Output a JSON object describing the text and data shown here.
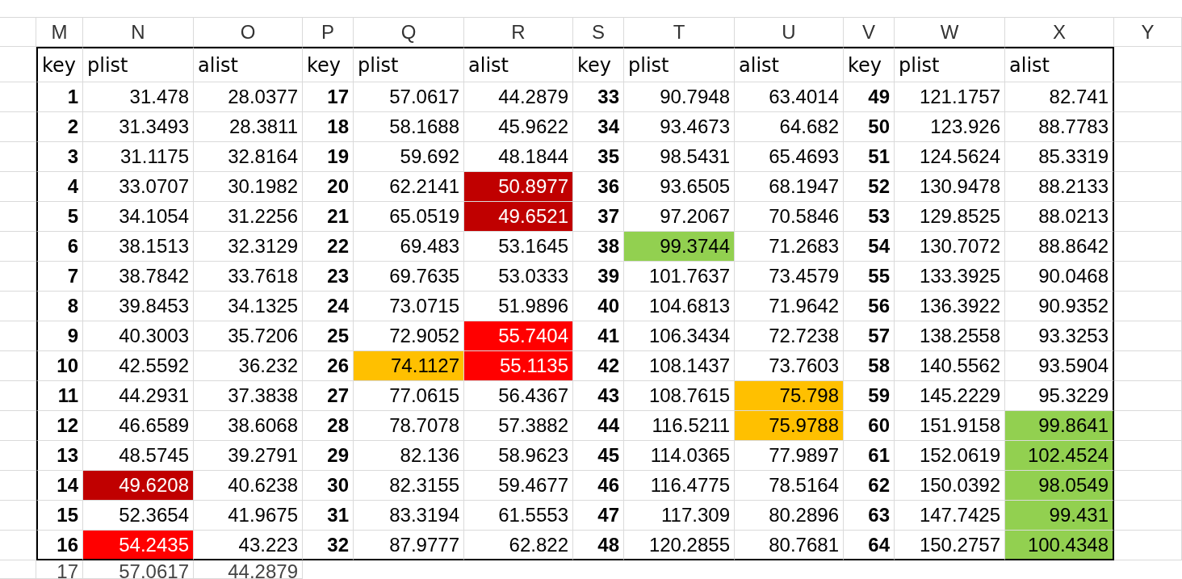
{
  "column_headers": [
    "M",
    "N",
    "O",
    "P",
    "Q",
    "R",
    "S",
    "T",
    "U",
    "V",
    "W",
    "X",
    "Y"
  ],
  "table": {
    "header": [
      "key",
      "plist",
      "alist",
      "key",
      "plist",
      "alist",
      "key",
      "plist",
      "alist",
      "key",
      "plist",
      "alist"
    ],
    "rows": [
      [
        "1",
        "31.478",
        "28.0377",
        "17",
        "57.0617",
        "44.2879",
        "33",
        "90.7948",
        "63.4014",
        "49",
        "121.1757",
        "82.741"
      ],
      [
        "2",
        "31.3493",
        "28.3811",
        "18",
        "58.1688",
        "45.9622",
        "34",
        "93.4673",
        "64.682",
        "50",
        "123.926",
        "88.7783"
      ],
      [
        "3",
        "31.1175",
        "32.8164",
        "19",
        "59.692",
        "48.1844",
        "35",
        "98.5431",
        "65.4693",
        "51",
        "124.5624",
        "85.3319"
      ],
      [
        "4",
        "33.0707",
        "30.1982",
        "20",
        "62.2141",
        {
          "text": "50.8977",
          "color": "#c00000"
        },
        "36",
        "93.6505",
        "68.1947",
        "52",
        "130.9478",
        "88.2133"
      ],
      [
        "5",
        "34.1054",
        "31.2256",
        "21",
        "65.0519",
        {
          "text": "49.6521",
          "color": "#c00000"
        },
        "37",
        "97.2067",
        "70.5846",
        "53",
        "129.8525",
        "88.0213"
      ],
      [
        "6",
        "38.1513",
        "32.3129",
        "22",
        "69.483",
        "53.1645",
        "38",
        {
          "text": "99.3744",
          "color": "#92d050"
        },
        "71.2683",
        "54",
        "130.7072",
        "88.8642"
      ],
      [
        "7",
        "38.7842",
        "33.7618",
        "23",
        "69.7635",
        "53.0333",
        "39",
        "101.7637",
        "73.4579",
        "55",
        "133.3925",
        "90.0468"
      ],
      [
        "8",
        "39.8453",
        "34.1325",
        "24",
        "73.0715",
        "51.9896",
        "40",
        "104.6813",
        "71.9642",
        "56",
        "136.3922",
        "90.9352"
      ],
      [
        "9",
        "40.3003",
        "35.7206",
        "25",
        "72.9052",
        {
          "text": "55.7404",
          "color": "#ff0000"
        },
        "41",
        "106.3434",
        "72.7238",
        "57",
        "138.2558",
        "93.3253"
      ],
      [
        "10",
        "42.5592",
        "36.232",
        "26",
        {
          "text": "74.1127",
          "color": "#ffc000"
        },
        {
          "text": "55.1135",
          "color": "#ff0000"
        },
        "42",
        "108.1437",
        "73.7603",
        "58",
        "140.5562",
        "93.5904"
      ],
      [
        "11",
        "44.2931",
        "37.3838",
        "27",
        "77.0615",
        "56.4367",
        "43",
        "108.7615",
        {
          "text": "75.798",
          "color": "#ffc000"
        },
        "59",
        "145.2229",
        "95.3229"
      ],
      [
        "12",
        "46.6589",
        "38.6068",
        "28",
        "78.7078",
        "57.3882",
        "44",
        "116.5211",
        {
          "text": "75.9788",
          "color": "#ffc000"
        },
        "60",
        "151.9158",
        {
          "text": "99.8641",
          "color": "#92d050"
        }
      ],
      [
        "13",
        "48.5745",
        "39.2791",
        "29",
        "82.136",
        "58.9623",
        "45",
        "114.0365",
        "77.9897",
        "61",
        "152.0619",
        {
          "text": "102.4524",
          "color": "#92d050"
        }
      ],
      [
        "14",
        {
          "text": "49.6208",
          "color": "#c00000"
        },
        "40.6238",
        "30",
        "82.3155",
        "59.4677",
        "46",
        "116.4775",
        "78.5164",
        "62",
        "150.0392",
        {
          "text": "98.0549",
          "color": "#92d050"
        }
      ],
      [
        "15",
        "52.3654",
        "41.9675",
        "31",
        "83.3194",
        "61.5553",
        "47",
        "117.309",
        "80.2896",
        "63",
        "147.7425",
        {
          "text": "99.431",
          "color": "#92d050"
        }
      ],
      [
        "16",
        {
          "text": "54.2435",
          "color": "#ff0000"
        },
        "43.223",
        "32",
        "87.9777",
        "62.822",
        "48",
        "120.2855",
        "80.7681",
        "64",
        "150.2757",
        {
          "text": "100.4348",
          "color": "#92d050"
        }
      ]
    ]
  },
  "partial_row": [
    "17",
    "57.0617",
    "44.2879"
  ]
}
